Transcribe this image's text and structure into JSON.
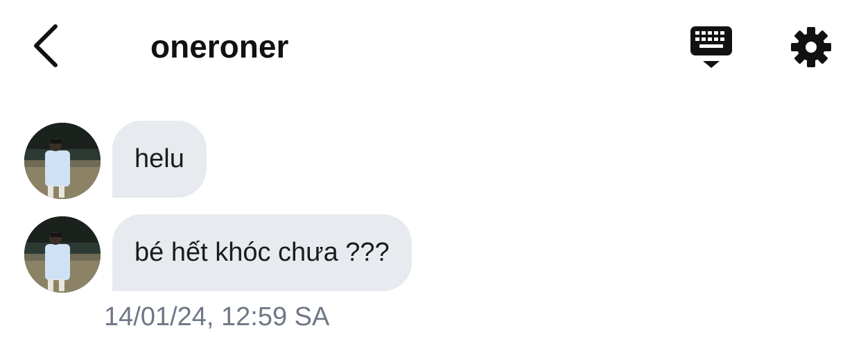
{
  "header": {
    "title": "oneroner",
    "back_icon": "chevron-left-icon",
    "keyboard_icon": "keyboard-icon",
    "settings_icon": "gear-icon"
  },
  "messages": [
    {
      "text": "helu",
      "avatar": "avatar-photo"
    },
    {
      "text": "bé hết khóc chưa ???",
      "avatar": "avatar-photo"
    }
  ],
  "timestamp": "14/01/24, 12:59 SA",
  "colors": {
    "bubble_bg": "#e7eaef",
    "timestamp": "#6e7785",
    "text": "#111111"
  }
}
